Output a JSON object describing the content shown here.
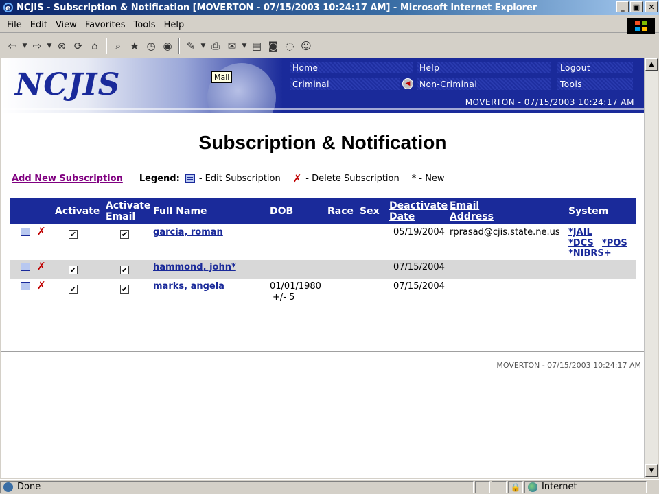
{
  "window": {
    "title": "NCJIS - Subscription & Notification [MOVERTON - 07/15/2003 10:24:17 AM] - Microsoft Internet Explorer",
    "min": "_",
    "max": "▣",
    "close": "✕"
  },
  "menu": {
    "file": "File",
    "edit": "Edit",
    "view": "View",
    "favorites": "Favorites",
    "tools": "Tools",
    "help": "Help"
  },
  "toolbar_icons": [
    "back-icon",
    "forward-icon",
    "stop-icon",
    "refresh-icon",
    "home-icon",
    "search-icon",
    "favorites-icon",
    "history-icon",
    "media-icon",
    "edit-page-icon",
    "print-icon",
    "mail-icon",
    "discuss-icon",
    "messenger-icon",
    "user-icon"
  ],
  "banner": {
    "logo": "NCJIS",
    "tooltip": "Mail",
    "nav": {
      "home": "Home",
      "help": "Help",
      "logout": "Logout",
      "criminal": "Criminal",
      "noncriminal": "Non-Criminal",
      "tools": "Tools"
    },
    "user": "MOVERTON - 07/15/2003 10:24:17 AM"
  },
  "page": {
    "title": "Subscription & Notification",
    "add_link": "Add New Subscription",
    "legend_label": "Legend:",
    "legend_edit": "- Edit Subscription",
    "legend_delete": "- Delete Subscription",
    "legend_new": "* - New"
  },
  "table": {
    "headers": {
      "activate": "Activate",
      "activate_email_1": "Activate",
      "activate_email_2": "Email",
      "full_name": "Full Name",
      "dob": "DOB",
      "race": "Race",
      "sex": "Sex",
      "deactivate_1": "Deactivate",
      "deactivate_2": "Date",
      "email_1": "Email",
      "email_2": "Address",
      "system": "System"
    },
    "rows": [
      {
        "full_name": "garcia, roman",
        "dob_1": "",
        "dob_2": "",
        "deactivate": "05/19/2004",
        "email": "rprasad@cjis.state.ne.us",
        "sys_1": "*JAIL",
        "sys_2": "*DCS",
        "sys_3": "*POS",
        "sys_4": "*NIBRS+",
        "activate": "✔",
        "activate_email": "✔"
      },
      {
        "full_name": "hammond, john*",
        "dob_1": "",
        "dob_2": "",
        "deactivate": "07/15/2004",
        "email": "",
        "activate": "✔",
        "activate_email": "✔"
      },
      {
        "full_name": "marks, angela",
        "dob_1": "01/01/1980",
        "dob_2": "+/- 5",
        "deactivate": "07/15/2004",
        "email": "",
        "activate": "✔",
        "activate_email": "✔"
      }
    ]
  },
  "footer": {
    "user": "MOVERTON - 07/15/2003 10:24:17 AM"
  },
  "status": {
    "done": "Done",
    "zone": "Internet",
    "lock": "🔒"
  },
  "colors": {
    "nav_blue": "#1a2a9a",
    "link_visited": "#800080",
    "delete_red": "#c00000"
  }
}
